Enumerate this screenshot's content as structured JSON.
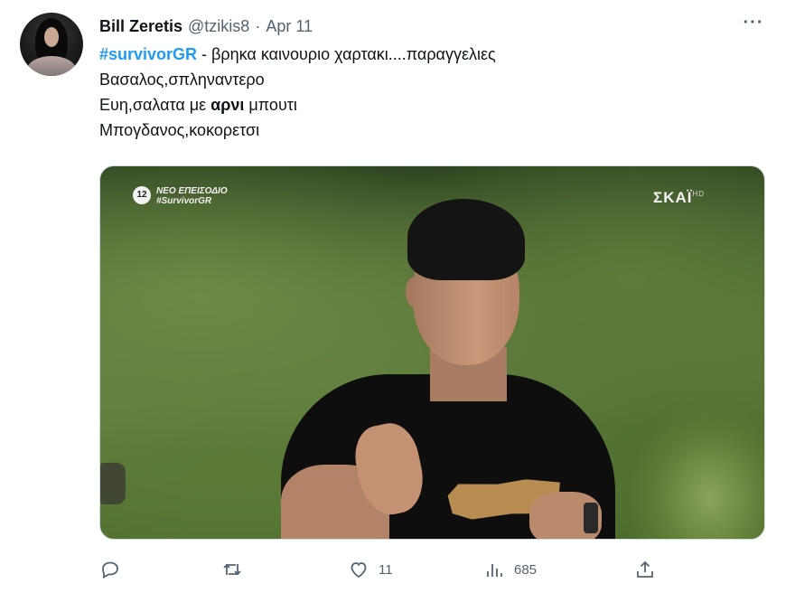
{
  "author": {
    "name": "Bill Zeretis",
    "handle": "@tzikis8",
    "separator": "·",
    "date": "Apr 11"
  },
  "more_icon": "···",
  "tweet": {
    "hashtag": "#survivorGR",
    "line1_rest": " - βρηκα καινουριο χαρτακι....παραγγελιες",
    "line2": "Βασαλος,σπληναντερο",
    "line3_before": "Ευη,σαλατα με ",
    "line3_bold": "αρνι",
    "line3_after": " μπουτι",
    "line4": "Μπογδανος,κοκορετσι"
  },
  "media": {
    "badge": "12",
    "episode_line1": "ΝΕΟ ΕΠΕΙΣΟΔΙΟ",
    "episode_line2": "#SurvivorGR",
    "channel": "ΣΚΑΪ",
    "channel_sup": "HD"
  },
  "actions": {
    "reply_icon": "reply-icon",
    "retweet_icon": "retweet-icon",
    "like_icon": "heart-icon",
    "like_count": "11",
    "views_icon": "views-icon",
    "views_count": "685",
    "share_icon": "share-icon"
  },
  "colors": {
    "accent": "#1d9bf0",
    "secondary_text": "#536471",
    "text": "#0f1419"
  }
}
